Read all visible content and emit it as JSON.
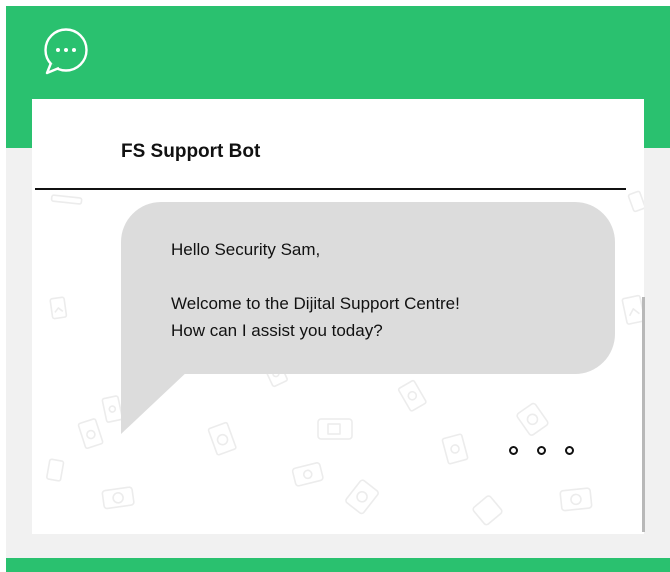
{
  "chat": {
    "title": "FS Support Bot",
    "icon": "chat-bubble-icon",
    "messages": [
      {
        "sender": "bot",
        "greeting": "Hello Security Sam,",
        "lines": [
          "Welcome to the Dijital Support Centre!",
          "How can I assist you today?"
        ]
      }
    ],
    "typing_indicator": "typing-dots-icon"
  },
  "colors": {
    "brand_green": "#2ac16f",
    "bubble_gray": "#dcdcdc",
    "frame_gray": "#f1f1f1",
    "text": "#111111"
  }
}
